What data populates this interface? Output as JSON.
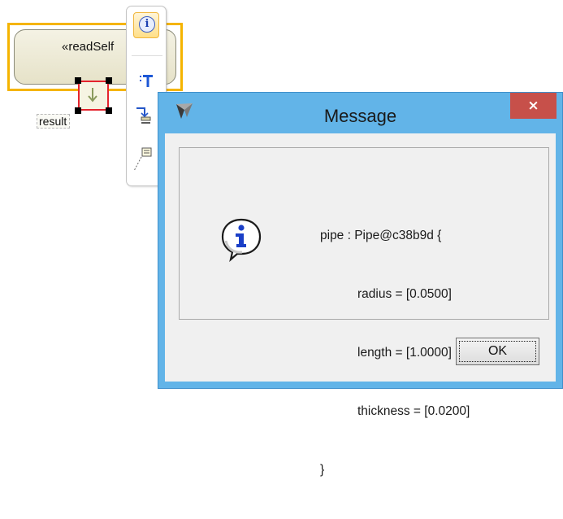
{
  "diagram": {
    "action_stereotype": "«readSelf",
    "pin_label": "result"
  },
  "toolbar": {
    "buttons": [
      "info-icon",
      "text-icon",
      "control-flow-icon",
      "note-icon"
    ]
  },
  "dialog": {
    "title": "Message",
    "close_label": "×",
    "message_lines": [
      "pipe : Pipe@c38b9d {",
      "radius = [0.0500]",
      "length = [1.0000]",
      "thickness = [0.0200]",
      "}"
    ],
    "ok_label": "OK"
  },
  "colors": {
    "title_bar": "#62b4e8",
    "close_button": "#c7504a",
    "selection_border": "#f5b400",
    "pin_selection": "#e4242e"
  }
}
